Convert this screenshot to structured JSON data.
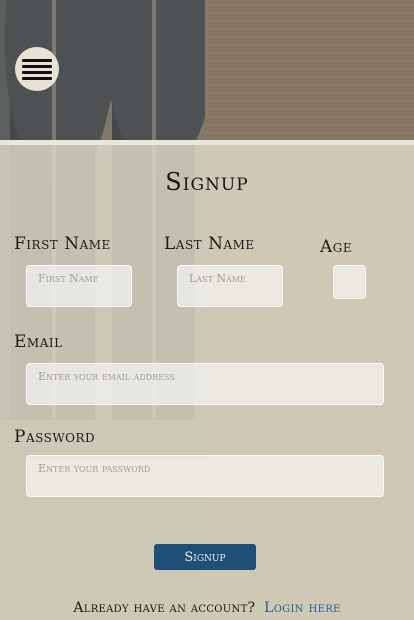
{
  "menu": {
    "icon": "hamburger-icon"
  },
  "form": {
    "title": "Signup",
    "first_name": {
      "label": "First Name",
      "placeholder": "First Name",
      "value": ""
    },
    "last_name": {
      "label": "Last Name",
      "placeholder": "Last Name",
      "value": ""
    },
    "age": {
      "label": "Age",
      "placeholder": "",
      "value": ""
    },
    "email": {
      "label": "Email",
      "placeholder": "Enter your email address",
      "value": ""
    },
    "password": {
      "label": "Password",
      "placeholder": "Enter your password",
      "value": ""
    },
    "submit_label": "Signup"
  },
  "footer": {
    "text": "Already have an account?",
    "link_label": "Login here"
  },
  "colors": {
    "button": "#1f4e77",
    "link": "#2a5d8a"
  }
}
